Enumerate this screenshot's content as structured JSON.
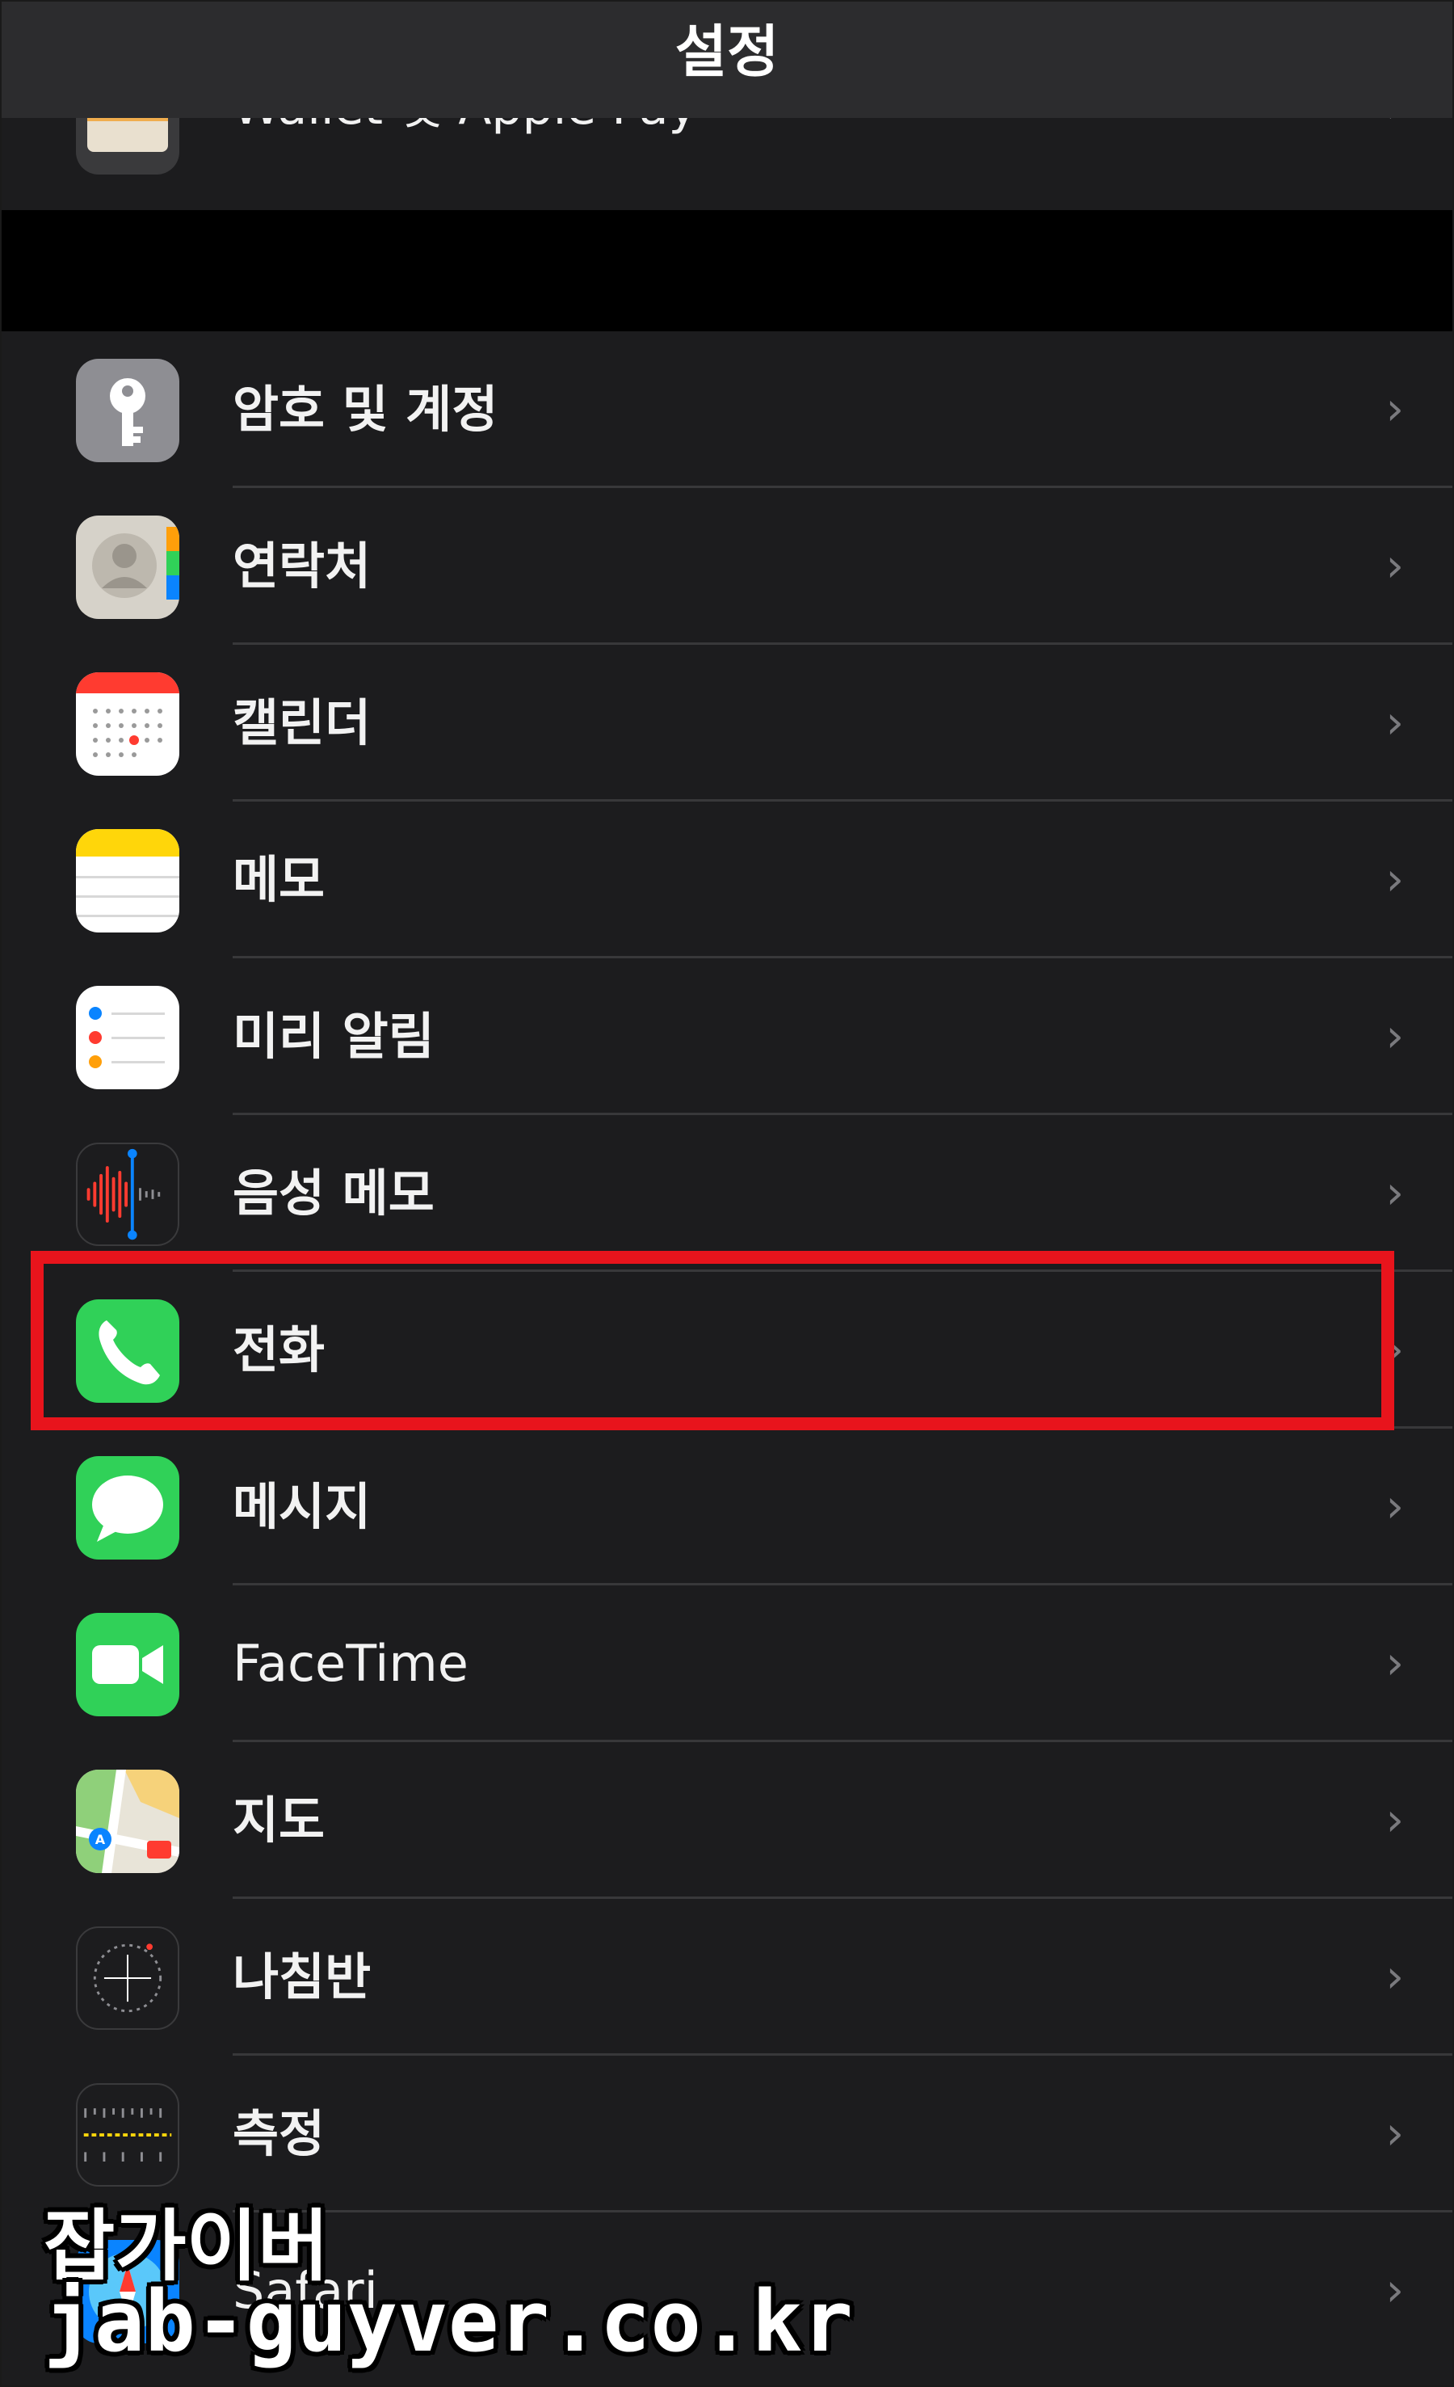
{
  "navbar": {
    "title": "설정"
  },
  "rows": {
    "wallet": "Wallet 및 Apple Pay",
    "passwords": "암호 및 계정",
    "contacts": "연락처",
    "calendar": "캘린더",
    "notes": "메모",
    "reminders": "미리 알림",
    "voice_memos": "음성 메모",
    "phone": "전화",
    "messages": "메시지",
    "facetime": "FaceTime",
    "maps": "지도",
    "compass": "나침반",
    "measure": "측정",
    "safari": "Safari"
  },
  "chevron": "›",
  "watermark": {
    "line1": "잡가이버",
    "line2": "jab-guyver.co.kr"
  },
  "colors": {
    "highlight": "#e8141c",
    "background": "#1c1c1e",
    "separator": "#38383a"
  }
}
